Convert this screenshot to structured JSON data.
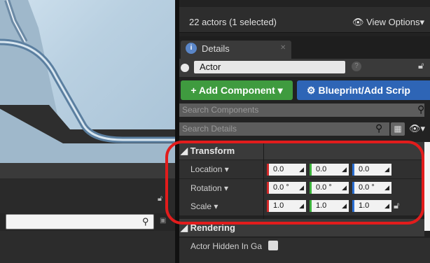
{
  "outliner": {
    "actors_count": "22 actors (1 selected)",
    "view_options": "View Options"
  },
  "details_tab": {
    "label": "Details"
  },
  "actor": {
    "name": "Actor"
  },
  "buttons": {
    "add_component": "+ Add Component ▾",
    "blueprint": "Blueprint/Add Scrip"
  },
  "search": {
    "components_placeholder": "Search Components",
    "details_placeholder": "Search Details"
  },
  "transform": {
    "title": "Transform",
    "rows": [
      {
        "label": "Location ▾",
        "x": "0.0",
        "y": "0.0",
        "z": "0.0"
      },
      {
        "label": "Rotation ▾",
        "x": "0.0 °",
        "y": "0.0 °",
        "z": "0.0 °"
      },
      {
        "label": "Scale ▾",
        "x": "1.0",
        "y": "1.0",
        "z": "1.0"
      }
    ]
  },
  "rendering": {
    "title": "Rendering",
    "actor_hidden_label": "Actor Hidden In Gar"
  },
  "colors": {
    "add_green": "#3f9b3f",
    "blueprint_blue": "#2e65b6",
    "highlight_red": "#e21c1c",
    "axis_x": "#d42a2a",
    "axis_y": "#3bb13b",
    "axis_z": "#2a6fd4"
  }
}
